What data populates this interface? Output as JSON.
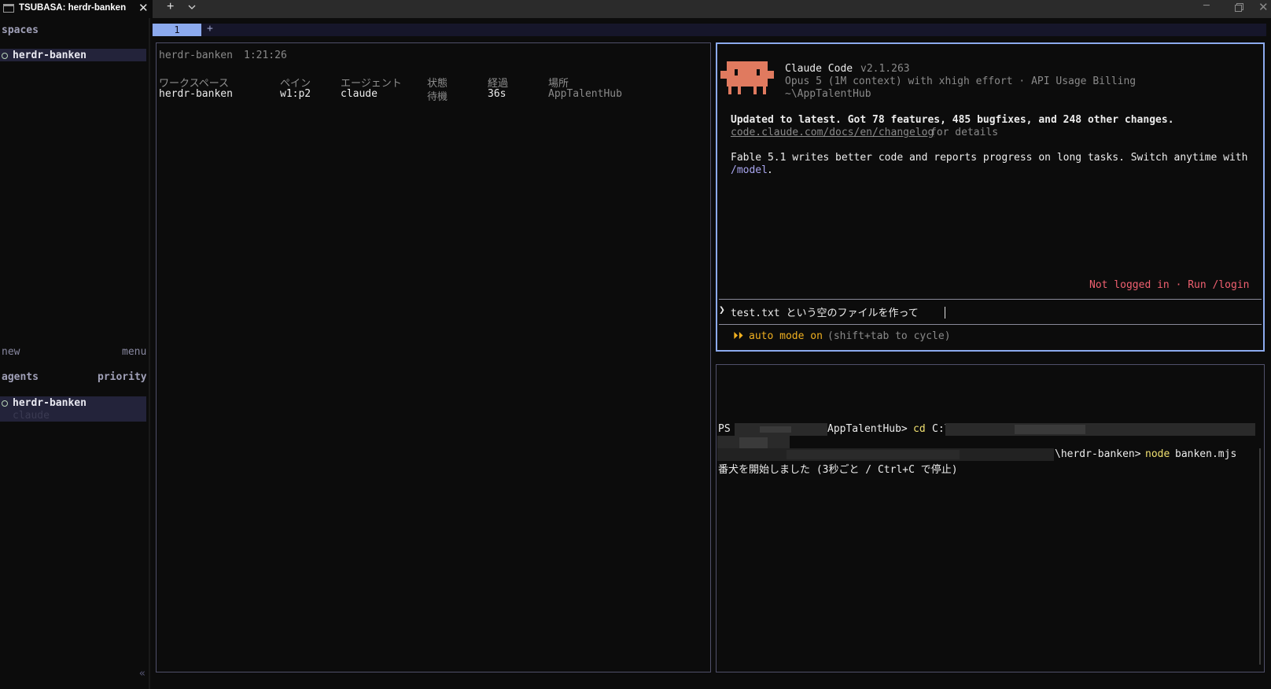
{
  "window": {
    "tab_title": "TSUBASA: herdr-banken",
    "tab_close": "✕",
    "new_tab": "+",
    "minimize": "─",
    "close": "✕"
  },
  "sidebar": {
    "spaces_heading": "spaces",
    "spaces": [
      {
        "name": "herdr-banken"
      }
    ],
    "new_label": "new",
    "menu_label": "menu",
    "agents_heading": "agents",
    "priority_label": "priority",
    "agents": [
      {
        "name": "herdr-banken",
        "agent": "claude"
      }
    ],
    "collapse": "«"
  },
  "workspace_tabs": {
    "tabs": [
      "1"
    ],
    "add": "+"
  },
  "overview": {
    "title": "herdr-banken",
    "time": "1:21:26",
    "columns": [
      "ワークスペース",
      "ペイン",
      "エージェント",
      "状態",
      "経過",
      "場所"
    ],
    "rows": [
      {
        "workspace": "herdr-banken",
        "pane": "w1:p2",
        "agent": "claude",
        "status": "待機",
        "elapsed": "36s",
        "location": "AppTalentHub"
      }
    ]
  },
  "claude": {
    "app_name": "Claude Code",
    "version": "v2.1.263",
    "model_line": "Opus 5 (1M context) with xhigh effort · API Usage Billing",
    "cwd": "~\\AppTalentHub",
    "update_line": "Updated to latest. Got 78 features, 485 bugfixes, and 248 other changes.",
    "changelog_link": "code.claude.com/docs/en/changelog",
    "changelog_suffix": " for details",
    "fable_line1": "Fable 5.1 writes better code and reports progress on long tasks. Switch anytime with",
    "fable_model_cmd": "/model",
    "fable_period": ".",
    "login_notice": "Not logged in · Run /login",
    "prompt_symbol": "❯",
    "prompt_text": "test.txt という空のファイルを作って",
    "auto_mode_icon": "⏵⏵",
    "auto_mode_label": "auto mode on",
    "auto_mode_hint": "(shift+tab to cycle)",
    "mascot_color": "#e07a5f"
  },
  "powershell": {
    "line1_prefix": "PS ",
    "line1_path_tail": "AppTalentHub>",
    "line1_cmd": "cd",
    "line1_arg": "C:\\",
    "line2_path_tail": "\\herdr-banken>",
    "line2_cmd": "node",
    "line2_arg": "banken.mjs",
    "line3": "番犬を開始しました (3秒ごと / Ctrl+C で停止)"
  }
}
